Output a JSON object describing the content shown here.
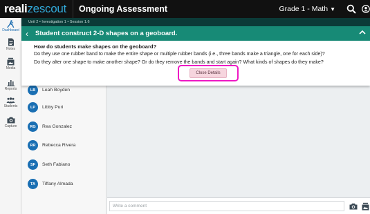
{
  "header": {
    "logo_part1": "reali",
    "logo_part2": "zescout",
    "title": "Ongoing Assessment",
    "grade_selector": "Grade 1 - Math"
  },
  "rail": {
    "items": [
      {
        "label": "Dashboard",
        "icon": "walker-icon"
      },
      {
        "label": "Notes",
        "icon": "document-icon"
      },
      {
        "label": "Media",
        "icon": "media-icon"
      },
      {
        "label": "Reports",
        "icon": "bar-chart-icon"
      },
      {
        "label": "Students",
        "icon": "people-icon"
      },
      {
        "label": "Capture",
        "icon": "camera-icon"
      }
    ]
  },
  "breadcrumb": "Unit 2 • Investigation 1 • Session 1.6",
  "banner": {
    "title": "Student construct 2-D shapes on a geoboard."
  },
  "details": {
    "question": "How do students make shapes on the geoboard?",
    "line1": "Do they use one rubber band to make the entire shape or multiple rubber bands (i.e., three bands make a triangle, one for each side)?",
    "line2": "Do they alter one shape to make another shape? Or do they remove the bands and start again? What kinds of shapes do they make?",
    "close_label": "Close Details"
  },
  "students": [
    {
      "initials": "LB",
      "name": "Leah Boyden"
    },
    {
      "initials": "LP",
      "name": "Libby Puri"
    },
    {
      "initials": "RG",
      "name": "Rea Gonzalez"
    },
    {
      "initials": "RR",
      "name": "Rebecca Rivera"
    },
    {
      "initials": "SF",
      "name": "Seth Fabiano"
    },
    {
      "initials": "TA",
      "name": "Tiffany Almada"
    }
  ],
  "comment": {
    "placeholder": "Write a comment"
  },
  "colors": {
    "accent": "#178a76",
    "avatar": "#1a6fb3",
    "highlight": "#ee18c4"
  }
}
